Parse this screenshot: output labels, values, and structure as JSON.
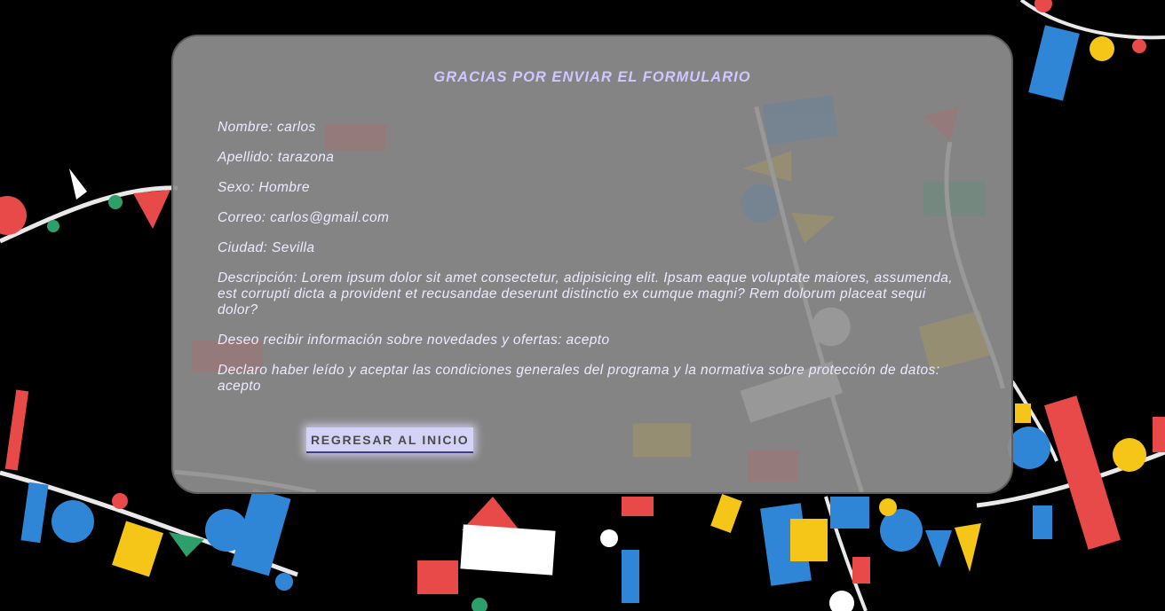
{
  "page": {
    "title": "GRACIAS POR ENVIAR EL FORMULARIO"
  },
  "fields": [
    {
      "key": "Nombre",
      "value": "carlos"
    },
    {
      "key": "Apellido",
      "value": "tarazona"
    },
    {
      "key": "Sexo",
      "value": "Hombre"
    },
    {
      "key": "Correo",
      "value": "carlos@gmail.com"
    },
    {
      "key": "Ciudad",
      "value": "Sevilla"
    },
    {
      "key": "Descripción",
      "value": "Lorem ipsum dolor sit amet consectetur, adipisicing elit. Ipsam eaque voluptate maiores, assumenda, est corrupti dicta a provident et recusandae deserunt distinctio ex cumque magni? Rem dolorum placeat sequi dolor?"
    },
    {
      "key": "Deseo recibir información sobre novedades y ofertas",
      "value": "acepto"
    },
    {
      "key": "Declaro haber leído y aceptar las condiciones generales del programa y la normativa sobre protección de datos",
      "value": "acepto"
    }
  ],
  "actions": {
    "back_label": "REGRESAR AL INICIO"
  },
  "colors": {
    "title": "#cfc8ff",
    "text": "#ecebff",
    "card": "#8e8e8e",
    "button": "#d4d2f6",
    "background": "#000000",
    "confetti": [
      "#e84a4a",
      "#2f86d6",
      "#f5c518",
      "#2e9e6a",
      "#ffffff"
    ]
  }
}
